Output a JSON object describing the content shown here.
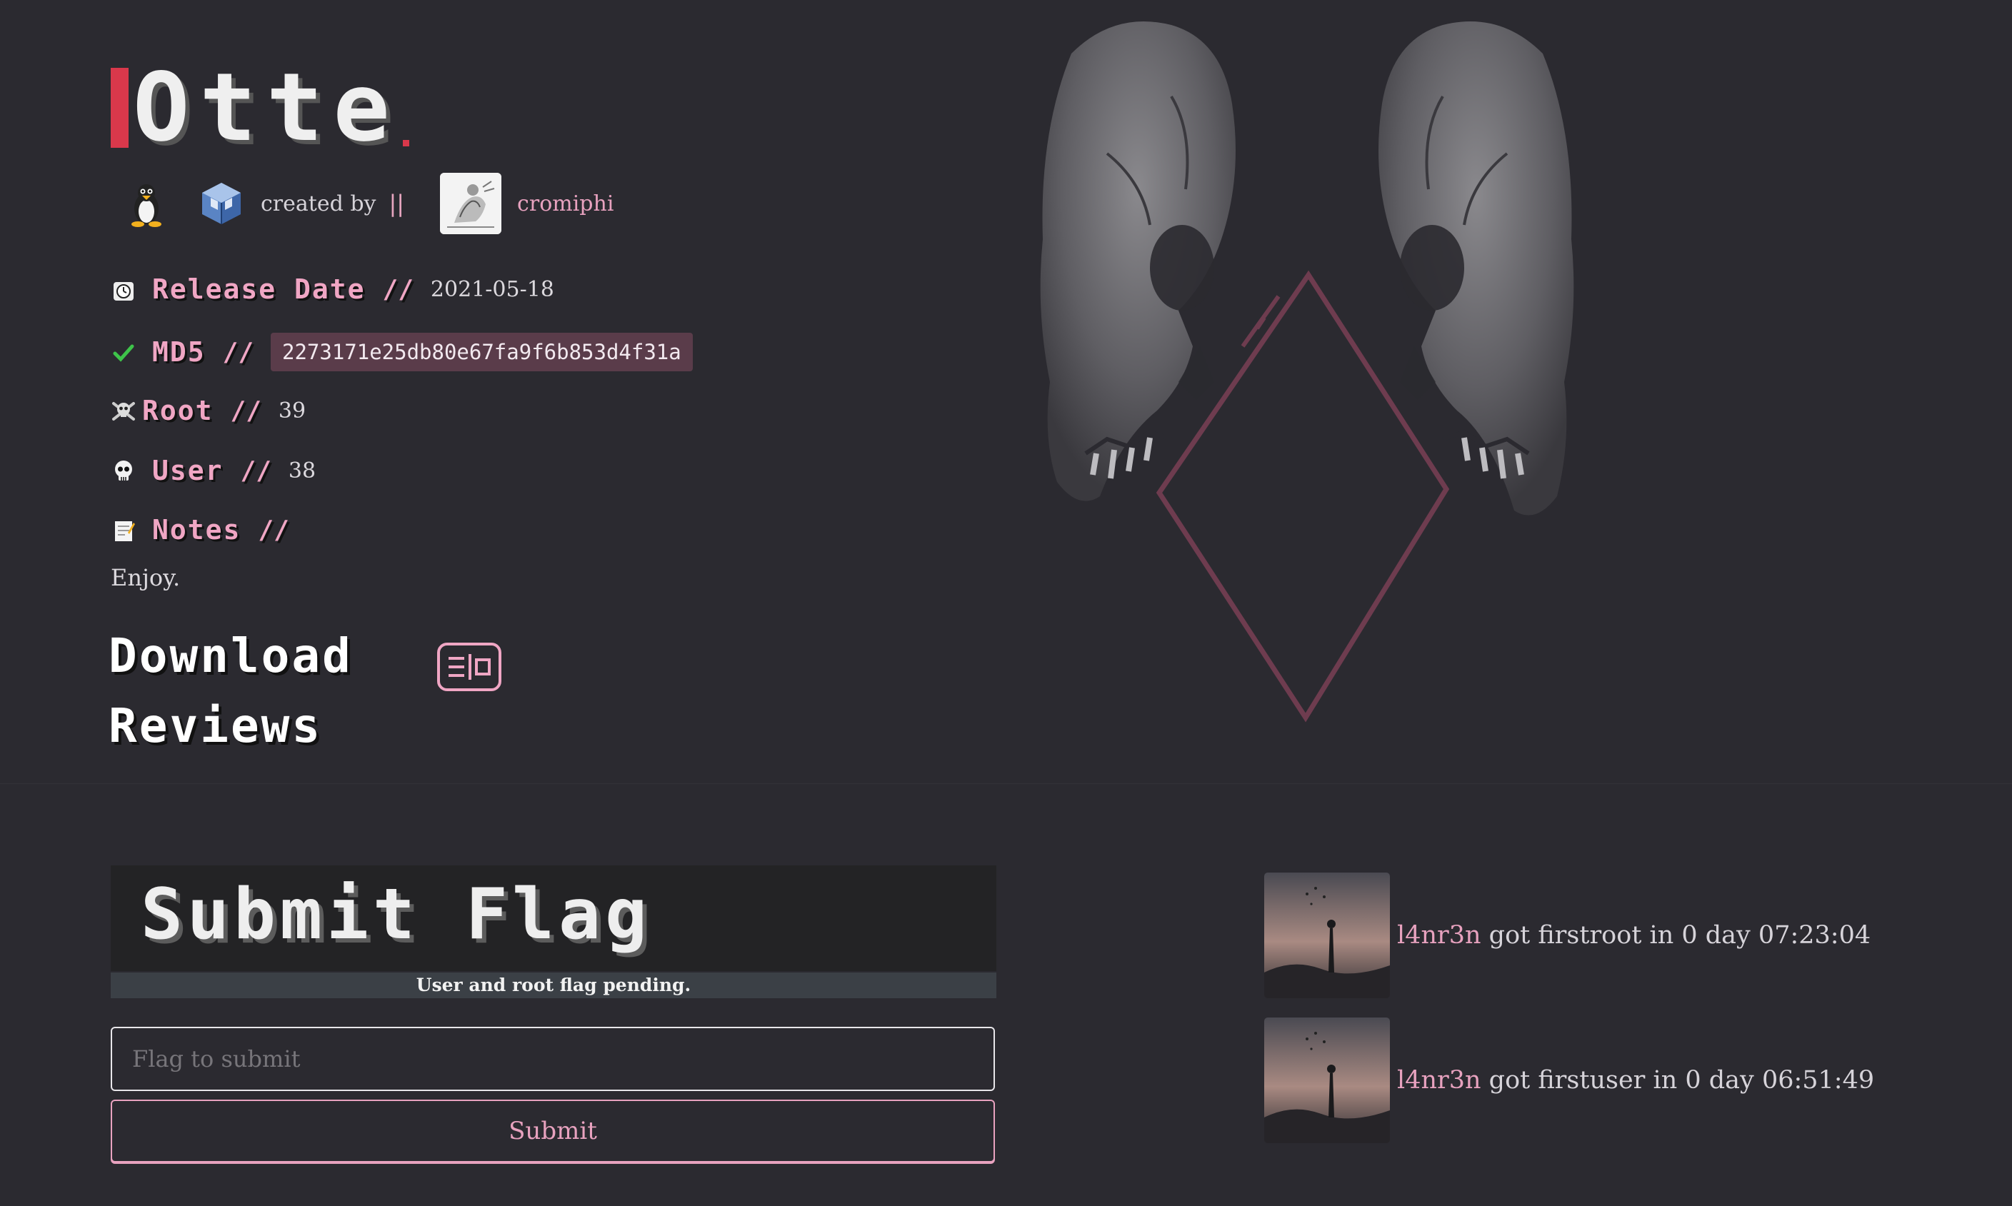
{
  "machine": {
    "name": "Otte"
  },
  "creator": {
    "created_by_label": "created by",
    "separator": "||",
    "name": "cromiphi"
  },
  "meta": {
    "release_date_label": "Release Date",
    "release_date": "2021-05-18",
    "md5_label": "MD5",
    "md5": "2273171e25db80e67fa9f6b853d4f31a",
    "root_label": "Root",
    "root_count": "39",
    "user_label": "User",
    "user_count": "38",
    "notes_label": "Notes",
    "notes": "Enjoy.",
    "slashes": "//"
  },
  "links": {
    "download": "Download",
    "reviews": "Reviews"
  },
  "flag": {
    "title": "Submit Flag",
    "status": "User and root flag pending.",
    "input_placeholder": "Flag to submit",
    "submit_label": "Submit"
  },
  "feed": [
    {
      "user": "l4nr3n",
      "text": " got firstroot in 0 day 07:23:04"
    },
    {
      "user": "l4nr3n",
      "text": " got firstuser in 0 day 06:51:49"
    }
  ],
  "colors": {
    "background": "#2b2a30",
    "accent_pink": "#e8a2bf",
    "accent_red": "#d9384b"
  },
  "icons": {
    "os": "linux-tux-icon",
    "platform": "virtualbox-icon",
    "release": "clock-icon",
    "md5": "checkmark-icon",
    "root": "skull-crossbones-icon",
    "user": "skull-icon",
    "notes": "memo-icon",
    "download": "download-card-icon"
  }
}
